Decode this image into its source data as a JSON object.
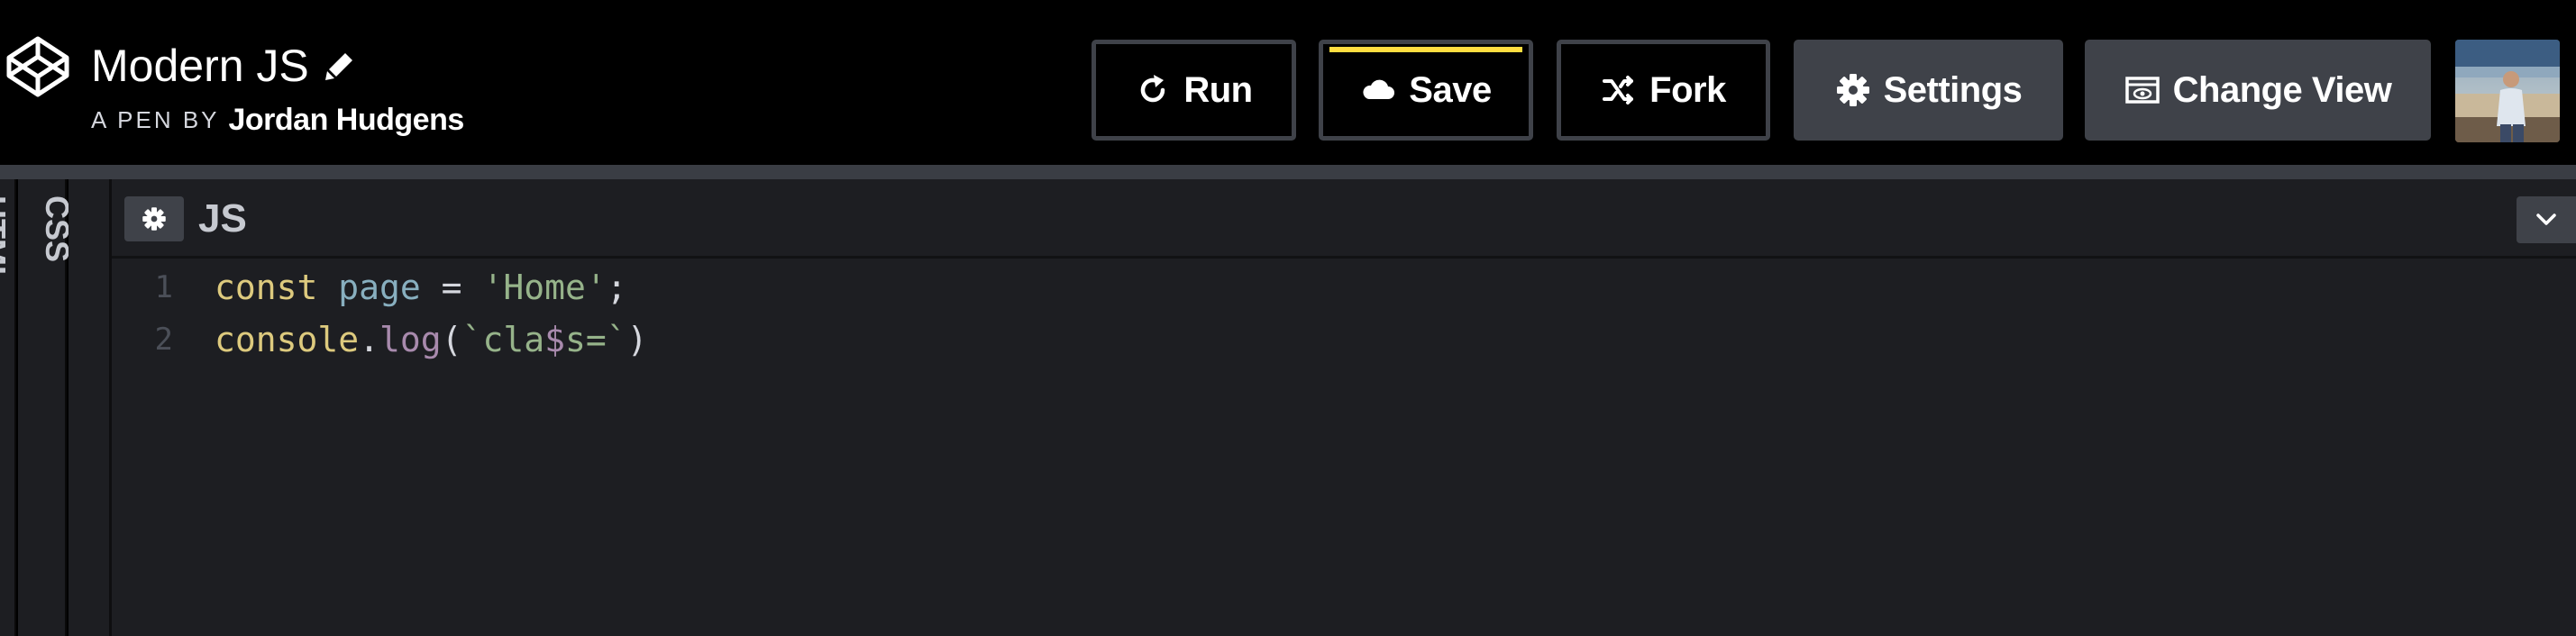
{
  "app": {
    "pen_title": "Modern JS",
    "byline_prefix": "A PEN BY",
    "author": "Jordan Hudgens"
  },
  "toolbar": {
    "run_label": "Run",
    "save_label": "Save",
    "fork_label": "Fork",
    "settings_label": "Settings",
    "change_view_label": "Change View",
    "save_accent_color": "#ffdd40"
  },
  "panels": {
    "collapsed": [
      {
        "label": "HTML"
      },
      {
        "label": "CSS"
      }
    ]
  },
  "editor": {
    "title": "JS",
    "lines": [
      {
        "number": "1",
        "tokens": [
          {
            "text": "const",
            "type": "keyword"
          },
          {
            "text": " ",
            "type": "punct"
          },
          {
            "text": "page",
            "type": "var"
          },
          {
            "text": " = ",
            "type": "punct"
          },
          {
            "text": "'Home'",
            "type": "string"
          },
          {
            "text": ";",
            "type": "punct"
          }
        ]
      },
      {
        "number": "2",
        "tokens": [
          {
            "text": "console",
            "type": "builtin"
          },
          {
            "text": ".",
            "type": "punct"
          },
          {
            "text": "log",
            "type": "method"
          },
          {
            "text": "(",
            "type": "punct"
          },
          {
            "text": "`cla",
            "type": "string"
          },
          {
            "text": "$",
            "type": "dollar"
          },
          {
            "text": "s=`",
            "type": "string"
          },
          {
            "text": ")",
            "type": "punct"
          }
        ]
      }
    ]
  },
  "icons": {
    "logo": "codepen-logo-icon",
    "edit": "pencil-icon",
    "run": "refresh-icon",
    "save": "cloud-icon",
    "fork": "fork-icon",
    "settings": "gear-icon",
    "change_view": "layout-icon",
    "editor_settings": "gear-icon",
    "collapse": "chevron-down-icon"
  }
}
